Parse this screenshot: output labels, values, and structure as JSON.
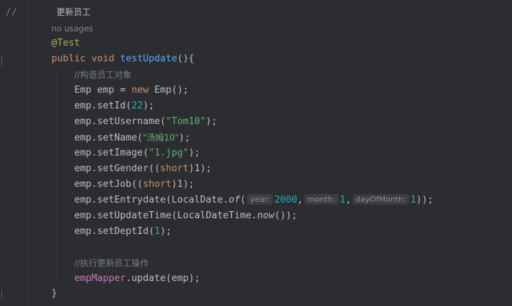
{
  "editor": {
    "header_comment_slashes": "//",
    "header_comment_text": "更新员工",
    "no_usages": "no usages",
    "annotation": "@Test",
    "method": {
      "kw_public": "public",
      "kw_void": "void",
      "name": "testUpdate",
      "open": "(){"
    },
    "comment_construct": "//构造员工对象",
    "line_emp_decl": {
      "type": "Emp emp = ",
      "kw_new": "new",
      "ctor": " Emp();"
    },
    "line_setId": {
      "pre": "emp.setId(",
      "num": "22",
      "post": ");"
    },
    "line_setUsername": {
      "pre": "emp.setUsername(",
      "str": "\"Tom10\"",
      "post": ");"
    },
    "line_setName": {
      "pre": "emp.setName(",
      "str": "\"汤姆10\"",
      "post": ");"
    },
    "line_setImage": {
      "pre": "emp.setImage(",
      "str": "\"1.jpg\"",
      "post": ");"
    },
    "line_setGender": {
      "pre": "emp.setGender((",
      "kw": "short",
      "post": ")1);"
    },
    "line_setJob": {
      "pre": "emp.setJob((",
      "kw": "short",
      "post": ")1);"
    },
    "line_setEntrydate": {
      "pre": "emp.setEntrydate(LocalDate.",
      "method": "of",
      "paren": "(",
      "hint_year": "year:",
      "year": "2000",
      "comma1": ",",
      "hint_month": "month:",
      "month": "1",
      "comma2": ",",
      "hint_day": "dayOfMonth:",
      "day": "1",
      "post": "));"
    },
    "line_setUpdateTime": {
      "pre": "emp.setUpdateTime(LocalDateTime.",
      "method": "now",
      "post": "());"
    },
    "line_setDeptId": {
      "pre": "emp.setDeptId(",
      "num": "1",
      "post": ");"
    },
    "comment_execute": "//执行更新员工操作",
    "line_update": {
      "field": "empMapper",
      "post": ".update(emp);"
    },
    "close_brace": "}"
  }
}
